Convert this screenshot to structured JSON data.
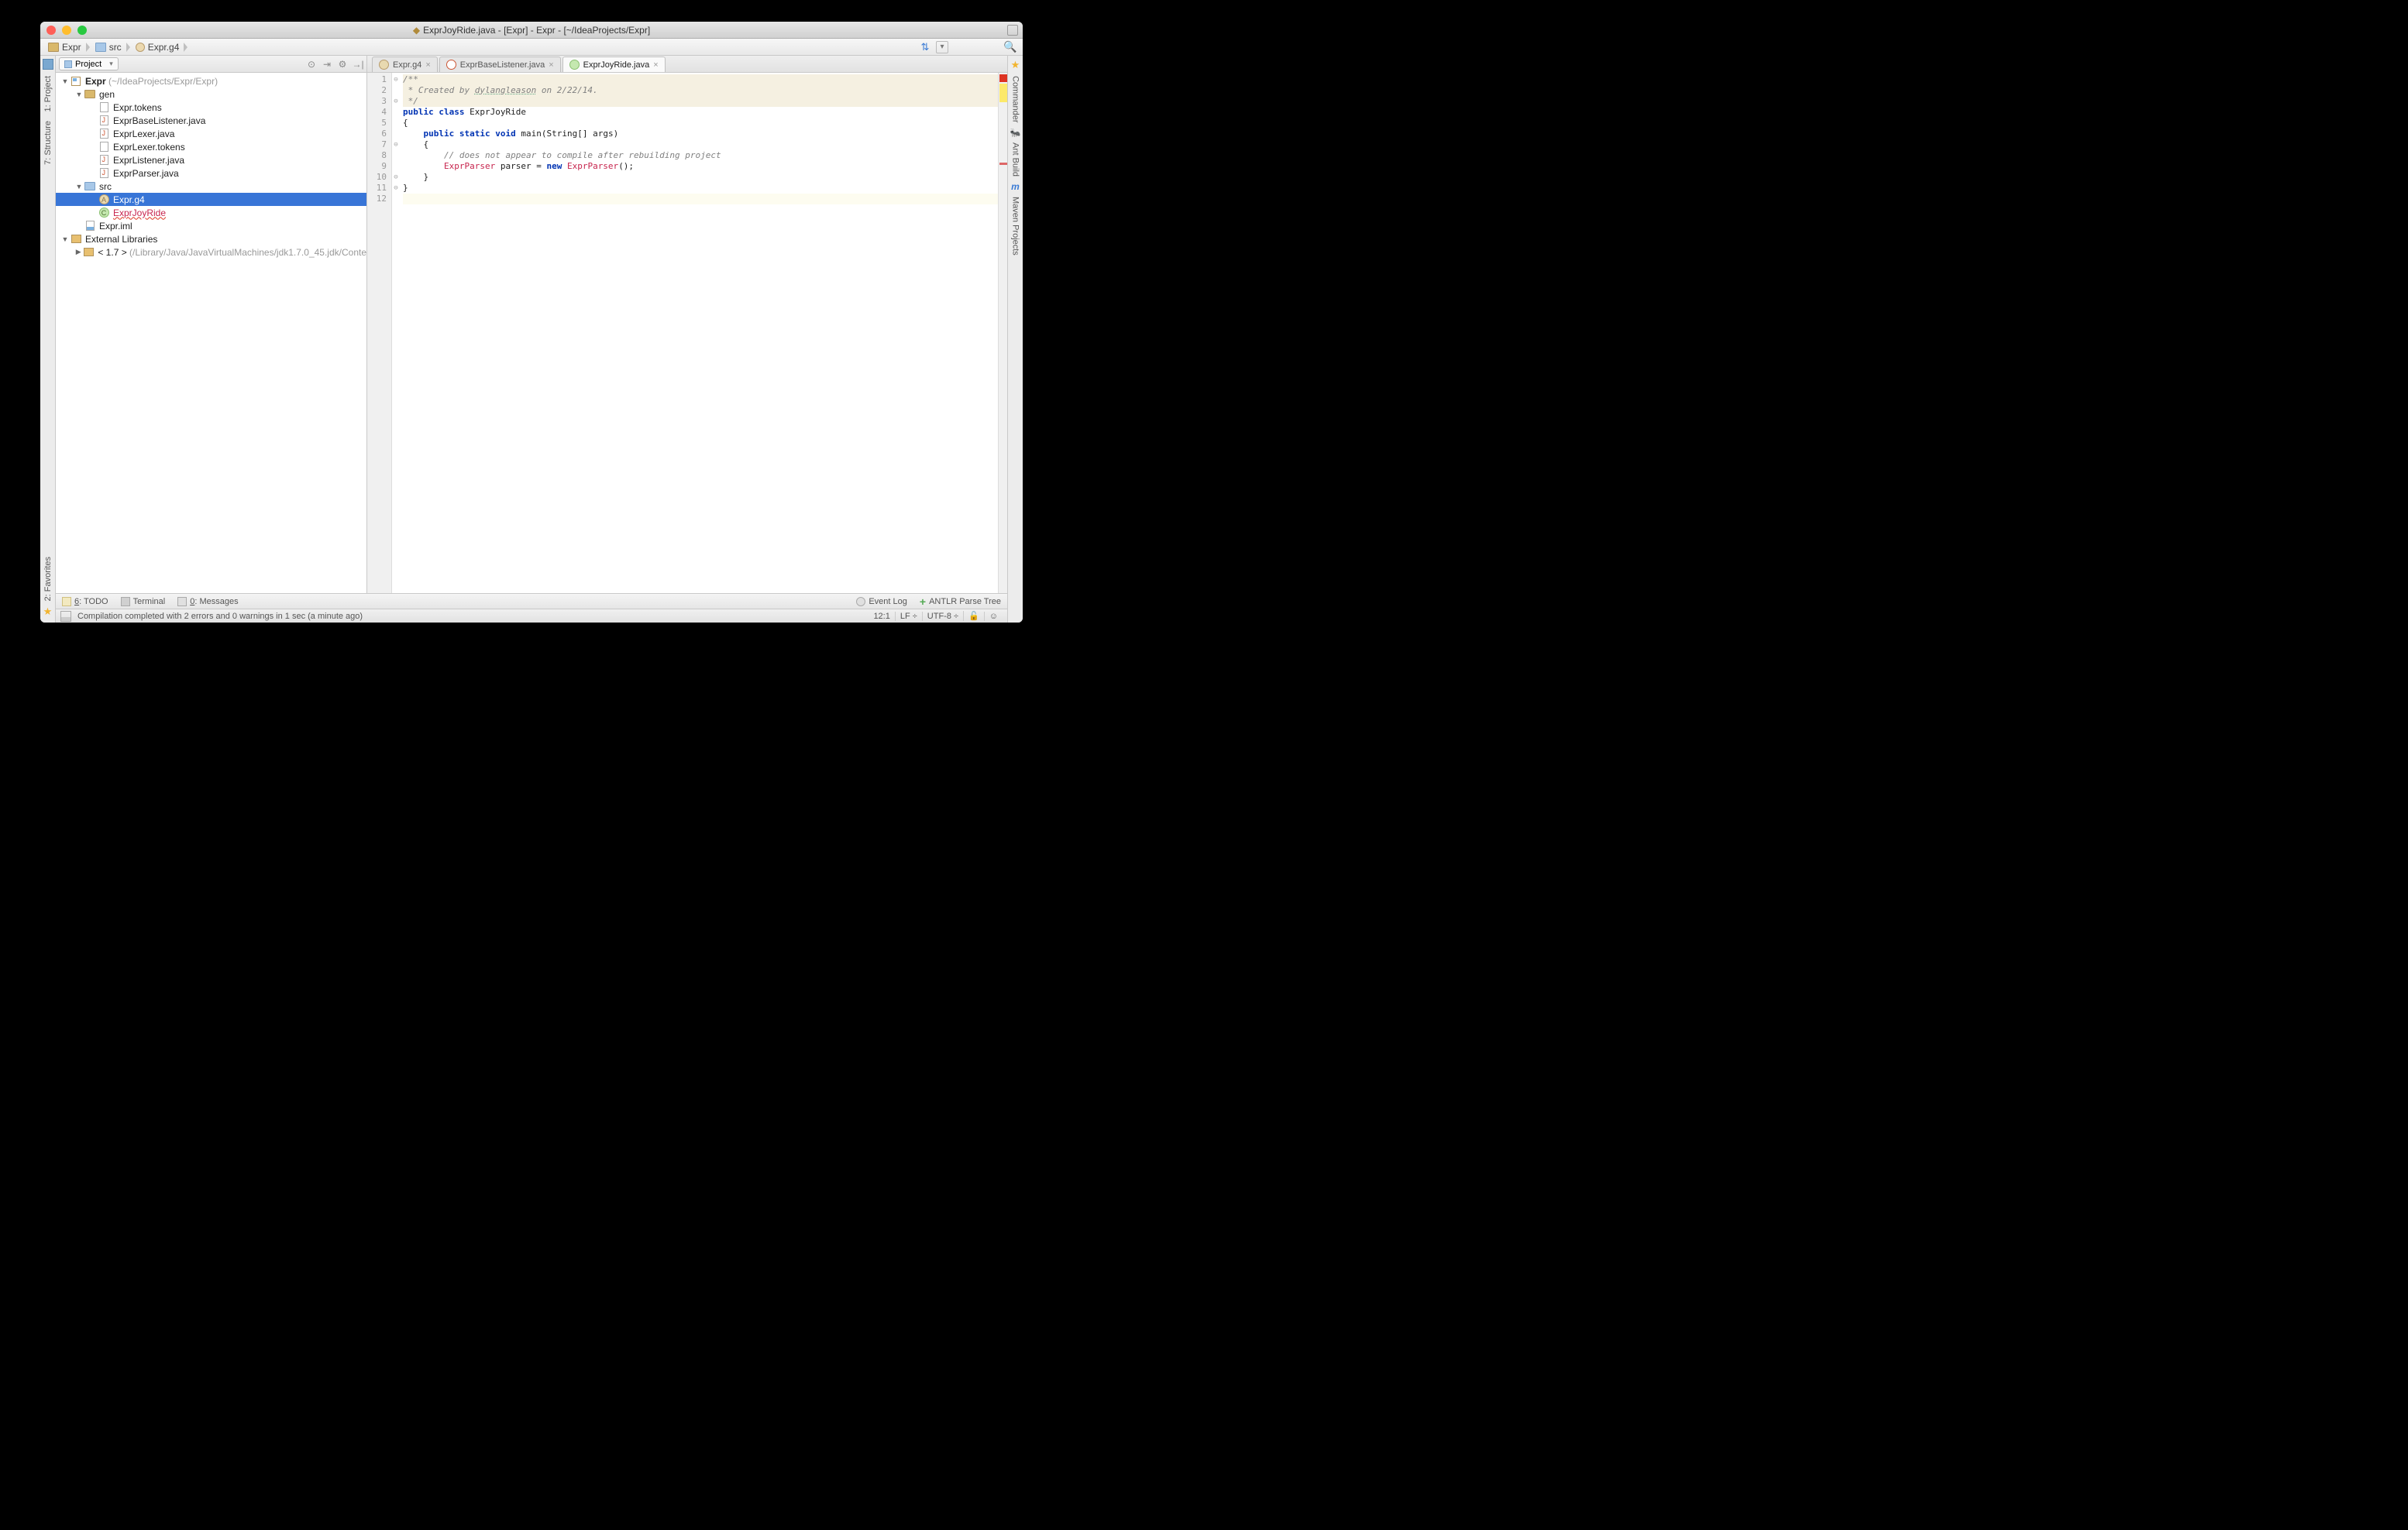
{
  "titlebar": {
    "title": "ExprJoyRide.java - [Expr] - Expr - [~/IdeaProjects/Expr]"
  },
  "breadcrumbs": [
    {
      "label": "Expr",
      "type": "folder"
    },
    {
      "label": "src",
      "type": "folder-blue"
    },
    {
      "label": "Expr.g4",
      "type": "g4"
    }
  ],
  "left_rail": [
    {
      "label": "1: Project",
      "key": "project"
    },
    {
      "label": "7: Structure",
      "key": "structure"
    },
    {
      "label": "2: Favorites",
      "key": "favorites"
    }
  ],
  "right_rail": [
    {
      "label": "Commander",
      "key": "commander"
    },
    {
      "label": "Ant Build",
      "key": "ant"
    },
    {
      "label": "Maven Projects",
      "key": "maven"
    }
  ],
  "project_panel": {
    "combo_label": "Project",
    "tree": [
      {
        "depth": 0,
        "arrow": "▼",
        "icon": "module",
        "label": "Expr",
        "suffix": " (~/IdeaProjects/Expr/Expr)"
      },
      {
        "depth": 1,
        "arrow": "▼",
        "icon": "folder",
        "label": "gen"
      },
      {
        "depth": 2,
        "arrow": "",
        "icon": "file",
        "label": "Expr.tokens"
      },
      {
        "depth": 2,
        "arrow": "",
        "icon": "file-java",
        "label": "ExprBaseListener.java"
      },
      {
        "depth": 2,
        "arrow": "",
        "icon": "file-java",
        "label": "ExprLexer.java"
      },
      {
        "depth": 2,
        "arrow": "",
        "icon": "file",
        "label": "ExprLexer.tokens"
      },
      {
        "depth": 2,
        "arrow": "",
        "icon": "file-java",
        "label": "ExprListener.java"
      },
      {
        "depth": 2,
        "arrow": "",
        "icon": "file-java",
        "label": "ExprParser.java"
      },
      {
        "depth": 1,
        "arrow": "▼",
        "icon": "folder-blue",
        "label": "src"
      },
      {
        "depth": 2,
        "arrow": "",
        "icon": "g4",
        "label": "Expr.g4",
        "selected": true
      },
      {
        "depth": 2,
        "arrow": "",
        "icon": "class",
        "label": "ExprJoyRide",
        "error": true
      },
      {
        "depth": 1,
        "arrow": "",
        "icon": "iml",
        "label": "Expr.iml"
      },
      {
        "depth": 0,
        "arrow": "▼",
        "icon": "libs",
        "label": "External Libraries"
      },
      {
        "depth": 1,
        "arrow": "▶",
        "icon": "libs",
        "label": "< 1.7 >",
        "suffix": " (/Library/Java/JavaVirtualMachines/jdk1.7.0_45.jdk/Conte"
      }
    ]
  },
  "tabs": [
    {
      "label": "Expr.g4",
      "icon": "g4",
      "active": false
    },
    {
      "label": "ExprBaseListener.java",
      "icon": "java",
      "active": false
    },
    {
      "label": "ExprJoyRide.java",
      "icon": "class",
      "active": true
    }
  ],
  "code": {
    "lines": [
      {
        "n": 1,
        "fold": "⊖",
        "html": "<span class='doc-bg'><span class='cm'>/**</span></span>"
      },
      {
        "n": 2,
        "fold": "",
        "html": "<span class='doc-bg'><span class='cm'> * Created by </span><span class='cm-auth'>dylangleason</span><span class='cm'> on 2/22/14.</span></span>"
      },
      {
        "n": 3,
        "fold": "⊖",
        "html": "<span class='doc-bg'><span class='cm'> */</span></span>"
      },
      {
        "n": 4,
        "fold": "",
        "html": "<span class='kw'>public</span> <span class='kw'>class</span> <span class='cls'>ExprJoyRide</span>"
      },
      {
        "n": 5,
        "fold": "",
        "html": "{"
      },
      {
        "n": 6,
        "fold": "",
        "html": "    <span class='kw'>public</span> <span class='kw'>static</span> <span class='kw'>void</span> main(String[] args)"
      },
      {
        "n": 7,
        "fold": "⊖",
        "html": "    {"
      },
      {
        "n": 8,
        "fold": "",
        "html": "        <span class='cm'>// does not appear to compile after rebuilding project</span>"
      },
      {
        "n": 9,
        "fold": "",
        "html": "        <span class='err'>ExprParser</span> parser = <span class='kw'>new</span> <span class='err'>ExprParser</span>();"
      },
      {
        "n": 10,
        "fold": "⊖",
        "html": "    }"
      },
      {
        "n": 11,
        "fold": "⊖",
        "html": "}"
      },
      {
        "n": 12,
        "fold": "",
        "html": "<span class='hl-line'> </span>"
      }
    ]
  },
  "bottom_tools": {
    "todo": "6: TODO",
    "terminal": "Terminal",
    "messages": "0: Messages",
    "event_log": "Event Log",
    "antlr": "ANTLR Parse Tree"
  },
  "status": {
    "message": "Compilation completed with 2 errors and 0 warnings in 1 sec (a minute ago)",
    "pos": "12:1",
    "line_sep": "LF",
    "encoding": "UTF-8",
    "todo_u": "6",
    "msg_u": "0"
  }
}
